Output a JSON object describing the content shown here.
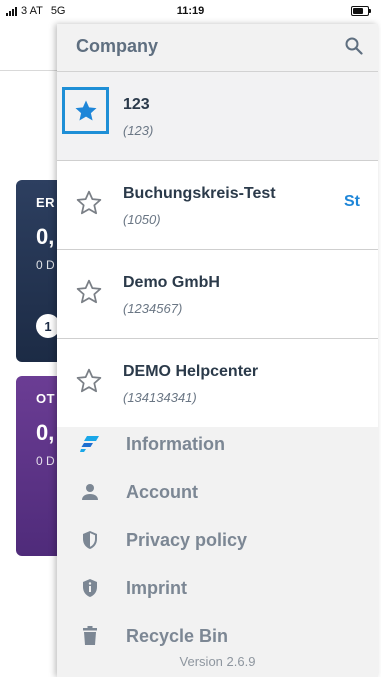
{
  "status_bar": {
    "carrier": "3 AT",
    "network": "5G",
    "time": "11:19"
  },
  "background": {
    "cards": [
      {
        "label": "ER",
        "value": "0,",
        "sub": "0 D",
        "badge": "1",
        "color": "#24365a"
      },
      {
        "label": "OT",
        "value": "0,",
        "sub": "0 D",
        "color": "#5e358a"
      }
    ]
  },
  "drawer": {
    "title": "Company",
    "companies": [
      {
        "name": "123",
        "code": "(123)",
        "favorite": true,
        "action": ""
      },
      {
        "name": "Buchungskreis-Test",
        "code": "(1050)",
        "favorite": false,
        "action": "St"
      },
      {
        "name": "Demo GmbH",
        "code": "(1234567)",
        "favorite": false,
        "action": ""
      },
      {
        "name": "DEMO Helpcenter",
        "code": "(134134341)",
        "favorite": false,
        "action": ""
      }
    ],
    "menu": [
      {
        "label": "Information",
        "icon": "information-icon"
      },
      {
        "label": "Account",
        "icon": "account-icon"
      },
      {
        "label": "Privacy policy",
        "icon": "shield-icon"
      },
      {
        "label": "Imprint",
        "icon": "info-shield-icon"
      },
      {
        "label": "Recycle Bin",
        "icon": "trash-icon"
      }
    ],
    "version": "Version 2.6.9"
  },
  "colors": {
    "accent": "#1e8fd6",
    "star_filled": "#1e86d8",
    "menu_text": "#7c8794"
  }
}
